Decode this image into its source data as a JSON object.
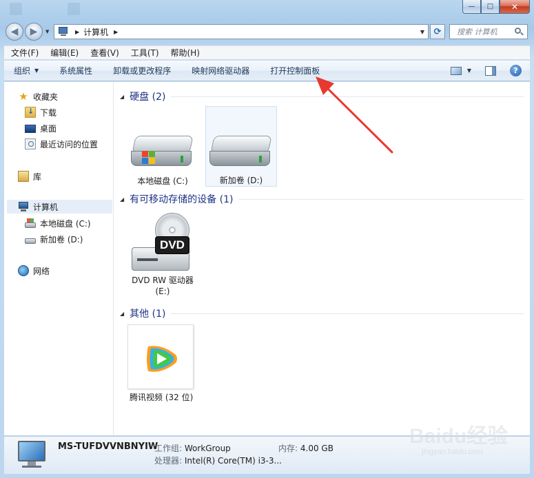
{
  "window": {
    "caption_buttons": {
      "minimize": "—",
      "maximize": "□",
      "close": "✕"
    }
  },
  "navigation": {
    "back_glyph": "◀",
    "forward_glyph": "▶",
    "dropdown_glyph": "▼"
  },
  "address_bar": {
    "crumbs": [
      "计算机"
    ],
    "separator": "▶",
    "dropdown_glyph": "▼",
    "refresh_glyph": "⟳"
  },
  "search": {
    "placeholder": "搜索 计算机"
  },
  "menu": [
    "文件(F)",
    "编辑(E)",
    "查看(V)",
    "工具(T)",
    "帮助(H)"
  ],
  "command_bar": {
    "organize": "组织",
    "system_properties": "系统属性",
    "uninstall": "卸载或更改程序",
    "map_drive": "映射网络驱动器",
    "control_panel": "打开控制面板",
    "help": "?"
  },
  "sidebar": {
    "favorites": "收藏夹",
    "downloads": "下载",
    "desktop": "桌面",
    "recent": "最近访问的位置",
    "libraries": "库",
    "computer": "计算机",
    "drive_c": "本地磁盘 (C:)",
    "drive_d": "新加卷 (D:)",
    "network": "网络"
  },
  "groups": {
    "hard_disks": "硬盘 (2)",
    "removable": "有可移动存储的设备 (1)",
    "other": "其他 (1)"
  },
  "items": {
    "drive_c": "本地磁盘 (C:)",
    "drive_d": "新加卷 (D:)",
    "dvd_line1": "DVD RW 驱动器",
    "dvd_line2": "(E:)",
    "dvd_tag": "DVD",
    "tencent_video": "腾讯视频 (32 位)"
  },
  "details": {
    "computer_name": "MS-TUFDVVNBNYIW",
    "workgroup_label": "工作组:",
    "workgroup_value": "WorkGroup",
    "memory_label": "内存:",
    "memory_value": "4.00 GB",
    "processor_label": "处理器:",
    "processor_value": "Intel(R) Core(TM) i3-3..."
  },
  "watermark": {
    "main": "Baidu经验",
    "sub": "jingyan.baidu.com"
  },
  "colors": {
    "annotation_arrow": "#e8392f",
    "group_title": "#1e3287",
    "aero_frame": "#bcd6ee"
  }
}
